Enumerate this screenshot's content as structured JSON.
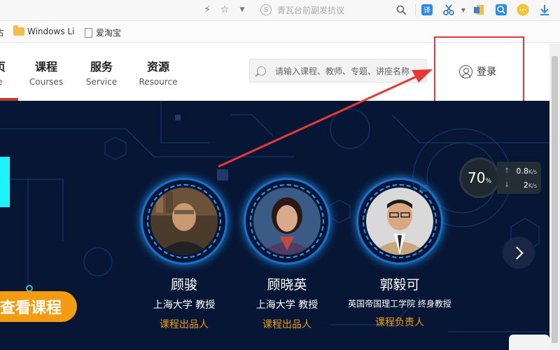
{
  "browser": {
    "omnibox_search": {
      "engine_icon": "S",
      "placeholder": "青瓦台前副发抗议"
    },
    "toolbar_icons": [
      "lightning-icon",
      "star-icon",
      "chevron-down-icon",
      "search-icon",
      "translate-icon",
      "scissors-icon",
      "extension-icon",
      "find-icon",
      "emoji-icon",
      "download-icon"
    ]
  },
  "bookmarks": {
    "left_fragment": "古",
    "items": [
      {
        "label": "Windows Li",
        "icon": "folder-icon"
      },
      {
        "label": "爱淘宝",
        "icon": "page-icon"
      }
    ]
  },
  "header": {
    "active_nav": {
      "cn": "页",
      "en": "e"
    },
    "nav": [
      {
        "cn": "课程",
        "en": "Courses"
      },
      {
        "cn": "服务",
        "en": "Service"
      },
      {
        "cn": "资源",
        "en": "Resource"
      }
    ],
    "search_placeholder": "请输入课程、教师、专题、讲座名称",
    "login_label": "登录"
  },
  "banner": {
    "cta_label": "查看课程",
    "teachers": [
      {
        "name": "顾骏",
        "org": "上海大学  教授",
        "role": "课程出品人"
      },
      {
        "name": "顾晓英",
        "org": "上海大学  教授",
        "role": "课程出品人"
      },
      {
        "name": "郭毅可",
        "org": "英国帝国理工学院  终身教授",
        "role": "课程负责人"
      }
    ]
  },
  "speed_widget": {
    "percent": "70",
    "percent_unit": "%",
    "upload": "0.8",
    "upload_unit": "K/s",
    "download": "2",
    "download_unit": "K/s"
  },
  "colors": {
    "accent_red": "#c0392b",
    "banner_bg": "#081635",
    "orange": "#f39c12",
    "cyan": "#1ff2ff",
    "annotation_red": "#e53935"
  }
}
